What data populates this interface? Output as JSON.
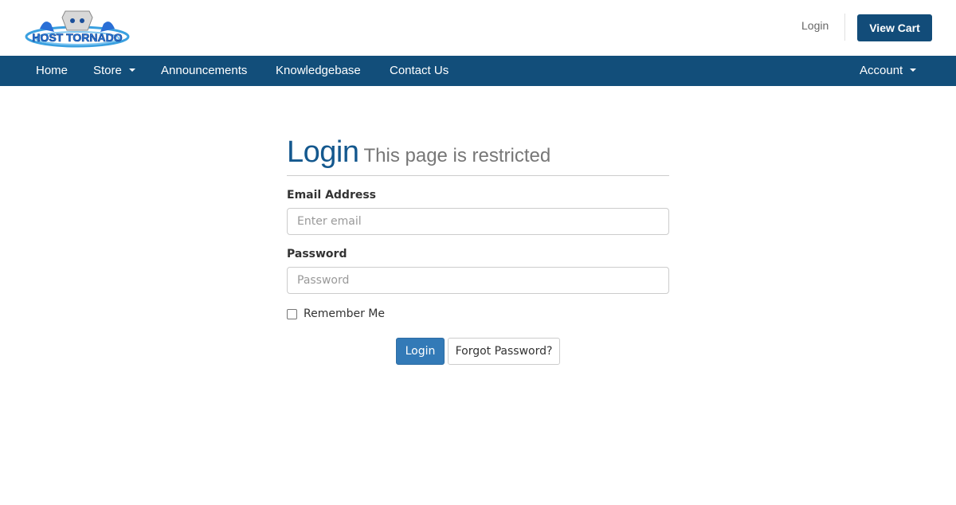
{
  "brand": {
    "logo_alt": "Host Tornado"
  },
  "topbar": {
    "login_link": "Login",
    "view_cart": "View Cart"
  },
  "nav": {
    "items": [
      {
        "label": "Home",
        "dropdown": false
      },
      {
        "label": "Store",
        "dropdown": true
      },
      {
        "label": "Announcements",
        "dropdown": false
      },
      {
        "label": "Knowledgebase",
        "dropdown": false
      },
      {
        "label": "Contact Us",
        "dropdown": false
      }
    ],
    "account": {
      "label": "Account",
      "dropdown": true
    }
  },
  "page": {
    "title": "Login",
    "subtitle": "This page is restricted"
  },
  "form": {
    "email": {
      "label": "Email Address",
      "placeholder": "Enter email",
      "value": ""
    },
    "password": {
      "label": "Password",
      "placeholder": "Password",
      "value": ""
    },
    "remember_me": {
      "label": "Remember Me",
      "checked": false
    },
    "login_button": "Login",
    "forgot_button": "Forgot Password?"
  },
  "colors": {
    "brand_dark": "#124e7a",
    "primary": "#337ab7",
    "title": "#14588e"
  }
}
